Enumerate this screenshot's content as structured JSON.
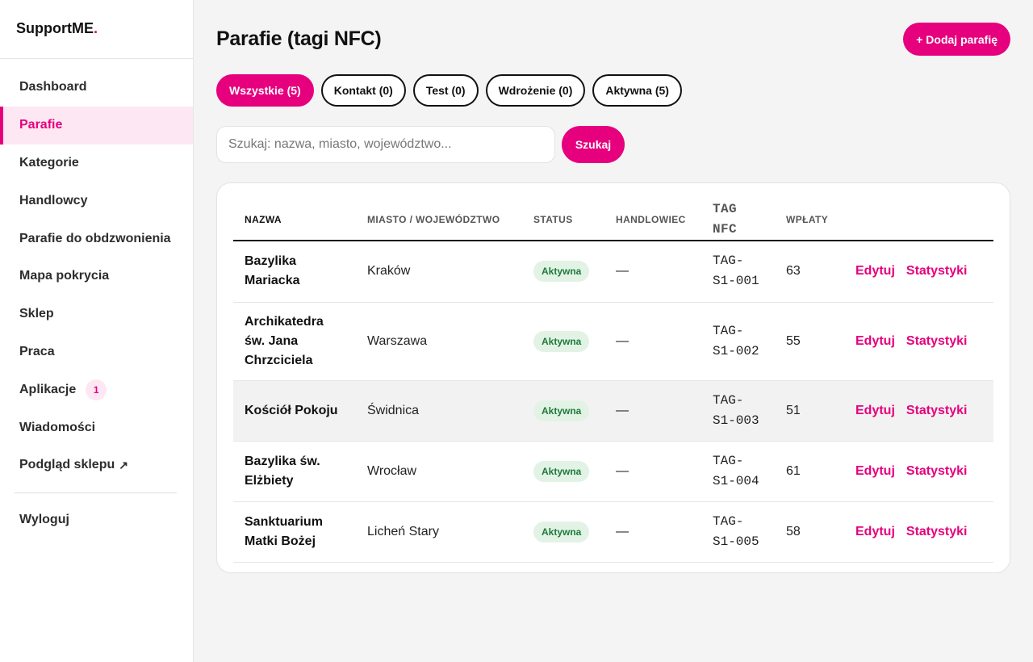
{
  "brand": {
    "name": "SupportME",
    "dot": "."
  },
  "sidebar": {
    "items": [
      {
        "label": "Dashboard"
      },
      {
        "label": "Parafie"
      },
      {
        "label": "Kategorie"
      },
      {
        "label": "Handlowcy"
      },
      {
        "label": "Parafie do obdzwonienia"
      },
      {
        "label": "Mapa pokrycia"
      },
      {
        "label": "Sklep"
      },
      {
        "label": "Praca"
      },
      {
        "label": "Aplikacje",
        "badge": "1"
      },
      {
        "label": "Wiadomości"
      },
      {
        "label": "Podgląd sklepu",
        "icon": "↗"
      }
    ],
    "logout": "Wyloguj"
  },
  "header": {
    "title": "Parafie (tagi NFC)",
    "add_button": "+ Dodaj parafię"
  },
  "filters": [
    {
      "label": "Wszystkie (5)"
    },
    {
      "label": "Kontakt (0)"
    },
    {
      "label": "Test (0)"
    },
    {
      "label": "Wdrożenie (0)"
    },
    {
      "label": "Aktywna (5)"
    }
  ],
  "search": {
    "placeholder": "Szukaj: nazwa, miasto, województwo...",
    "button": "Szukaj"
  },
  "table": {
    "columns": [
      "NAZWA",
      "MIASTO / WOJEWÓDZTWO",
      "STATUS",
      "HANDLOWIEC",
      "TAG NFC",
      "WPŁATY"
    ],
    "rows": [
      {
        "name": "Bazylika Mariacka",
        "city": "Kraków",
        "status": "Aktywna",
        "rep": "—",
        "tag": "TAG-\nS1-001",
        "payments": "63"
      },
      {
        "name": "Archikatedra św. Jana Chrzciciela",
        "city": "Warszawa",
        "status": "Aktywna",
        "rep": "—",
        "tag": "TAG-\nS1-002",
        "payments": "55"
      },
      {
        "name": "Kościół Pokoju",
        "city": "Świdnica",
        "status": "Aktywna",
        "rep": "—",
        "tag": "TAG-\nS1-003",
        "payments": "51"
      },
      {
        "name": "Bazylika św. Elżbiety",
        "city": "Wrocław",
        "status": "Aktywna",
        "rep": "—",
        "tag": "TAG-\nS1-004",
        "payments": "61"
      },
      {
        "name": "Sanktuarium Matki Bożej",
        "city": "Licheń Stary",
        "status": "Aktywna",
        "rep": "—",
        "tag": "TAG-\nS1-005",
        "payments": "58"
      }
    ],
    "actions": {
      "edit": "Edytuj",
      "stats": "Statystyki"
    }
  },
  "colors": {
    "accent": "#e6007e",
    "status_bg": "#e2f3e6",
    "status_text": "#1f7a3a"
  }
}
